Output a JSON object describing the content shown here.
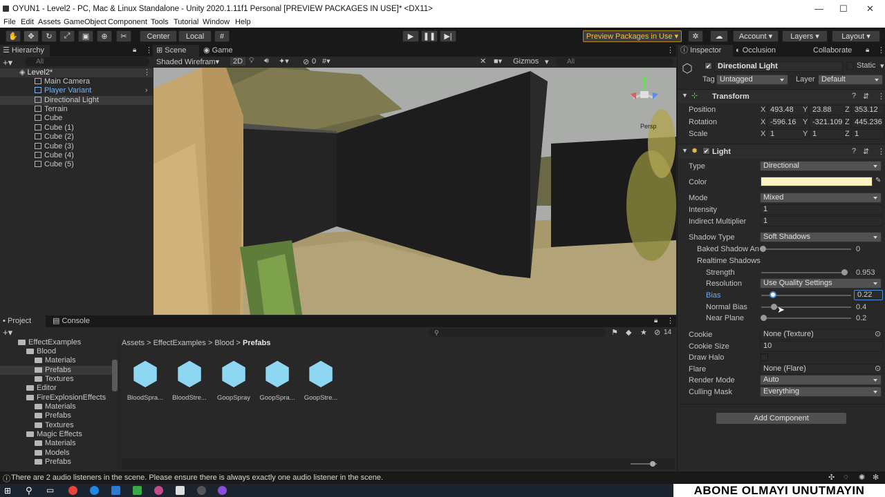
{
  "window": {
    "title": "OYUN1 - Level2 - PC, Mac & Linux Standalone - Unity 2020.1.11f1 Personal [PREVIEW PACKAGES IN USE]* <DX11>",
    "min": "—",
    "max": "☐",
    "close": "✕"
  },
  "menu": [
    "File",
    "Edit",
    "Assets",
    "GameObject",
    "Component",
    "Tools",
    "Tutorial",
    "Window",
    "Help"
  ],
  "toolbar": {
    "center": "Center",
    "local": "Local",
    "preview": "Preview Packages in Use ▾",
    "account": "Account",
    "layers": "Layers",
    "layout": "Layout"
  },
  "hierarchy": {
    "tab": "Hierarchy",
    "search_placeholder": "All",
    "scene": "Level2*",
    "items": [
      "Main Camera",
      "Player Variant",
      "Directional Light",
      "Terrain",
      "Cube",
      "Cube (1)",
      "Cube (2)",
      "Cube (3)",
      "Cube (4)",
      "Cube (5)"
    ]
  },
  "scene": {
    "tab_scene": "Scene",
    "tab_game": "Game",
    "shading": "Shaded Wirefram▾",
    "mode2d": "2D",
    "hidden_count": "0",
    "gizmos": "Gizmos",
    "search_placeholder": "All",
    "persp": "Persp"
  },
  "project": {
    "tab_project": "Project",
    "tab_console": "Console",
    "tree": [
      {
        "label": "EffectExamples",
        "level": 1
      },
      {
        "label": "Blood",
        "level": 2
      },
      {
        "label": "Materials",
        "level": 3
      },
      {
        "label": "Prefabs",
        "level": 3
      },
      {
        "label": "Textures",
        "level": 3
      },
      {
        "label": "Editor",
        "level": 2
      },
      {
        "label": "FireExplosionEffects",
        "level": 2
      },
      {
        "label": "Materials",
        "level": 3
      },
      {
        "label": "Prefabs",
        "level": 3
      },
      {
        "label": "Textures",
        "level": 3
      },
      {
        "label": "Magic Effects",
        "level": 2
      },
      {
        "label": "Materials",
        "level": 3
      },
      {
        "label": "Models",
        "level": 3
      },
      {
        "label": "Prefabs",
        "level": 3
      }
    ],
    "breadcrumb": [
      "Assets",
      "EffectExamples",
      "Blood",
      "Prefabs"
    ],
    "assets": [
      "BloodSpra...",
      "BloodStre...",
      "GoopSpray",
      "GoopSpra...",
      "GoopStre..."
    ],
    "hidden_count": "14"
  },
  "inspector": {
    "tab": "Inspector",
    "tab_occlusion": "Occlusion",
    "tab_collab": "Collaborate",
    "object_name": "Directional Light",
    "static": "Static",
    "tag_label": "Tag",
    "tag": "Untagged",
    "layer_label": "Layer",
    "layer": "Default",
    "transform": {
      "title": "Transform",
      "position": {
        "label": "Position",
        "x": "493.48",
        "y": "23.88",
        "z": "353.12"
      },
      "rotation": {
        "label": "Rotation",
        "x": "-596.16",
        "y": "-321.109",
        "z": "445.236"
      },
      "scale": {
        "label": "Scale",
        "x": "1",
        "y": "1",
        "z": "1"
      }
    },
    "light": {
      "title": "Light",
      "type_label": "Type",
      "type": "Directional",
      "color_label": "Color",
      "color": "#fdf5c3",
      "mode_label": "Mode",
      "mode": "Mixed",
      "intensity_label": "Intensity",
      "intensity": "1",
      "indirect_label": "Indirect Multiplier",
      "indirect": "1",
      "shadow_type_label": "Shadow Type",
      "shadow_type": "Soft Shadows",
      "baked_angle_label": "Baked Shadow An",
      "baked_angle": "0",
      "realtime_label": "Realtime Shadows",
      "strength_label": "Strength",
      "strength": "0.953",
      "resolution_label": "Resolution",
      "resolution": "Use Quality Settings",
      "bias_label": "Bias",
      "bias": "0.22",
      "normal_bias_label": "Normal Bias",
      "normal_bias": "0.4",
      "near_plane_label": "Near Plane",
      "near_plane": "0.2",
      "cookie_label": "Cookie",
      "cookie": "None (Texture)",
      "cookie_size_label": "Cookie Size",
      "cookie_size": "10",
      "draw_halo_label": "Draw Halo",
      "flare_label": "Flare",
      "flare": "None (Flare)",
      "render_mode_label": "Render Mode",
      "render_mode": "Auto",
      "culling_label": "Culling Mask",
      "culling": "Everything"
    },
    "add_component": "Add Component"
  },
  "status": {
    "message": "There are 2 audio listeners in the scene. Please ensure there is always exactly one audio listener in the scene."
  },
  "overlay": {
    "text": "ABONE OLMAYI UNUTMAYIN"
  }
}
